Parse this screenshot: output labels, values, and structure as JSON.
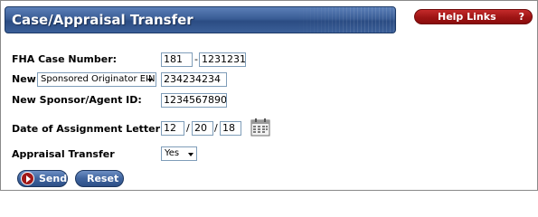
{
  "header": {
    "title": "Case/Appraisal Transfer",
    "help_links_label": "Help Links",
    "help_icon_glyph": "?",
    "title_bar_color": "#3a5d96",
    "help_links_color": "#9e1414"
  },
  "form": {
    "fha_case_number": {
      "label": "FHA Case Number:",
      "part1": "181",
      "separator": "-",
      "part2": "1231231"
    },
    "new_originator": {
      "label": "New",
      "select_value": "Sponsored Originator EIN:",
      "value": "234234234"
    },
    "new_sponsor": {
      "label": "New Sponsor/Agent ID:",
      "value": "1234567890"
    },
    "assignment_date": {
      "label": "Date of Assignment Letter:",
      "month": "12",
      "day": "20",
      "year": "18",
      "separator": "/",
      "calendar_icon": "calendar-icon"
    },
    "appraisal_transfer": {
      "label": "Appraisal Transfer",
      "select_value": "Yes"
    }
  },
  "buttons": {
    "send_label": "Send",
    "reset_label": "Reset"
  }
}
